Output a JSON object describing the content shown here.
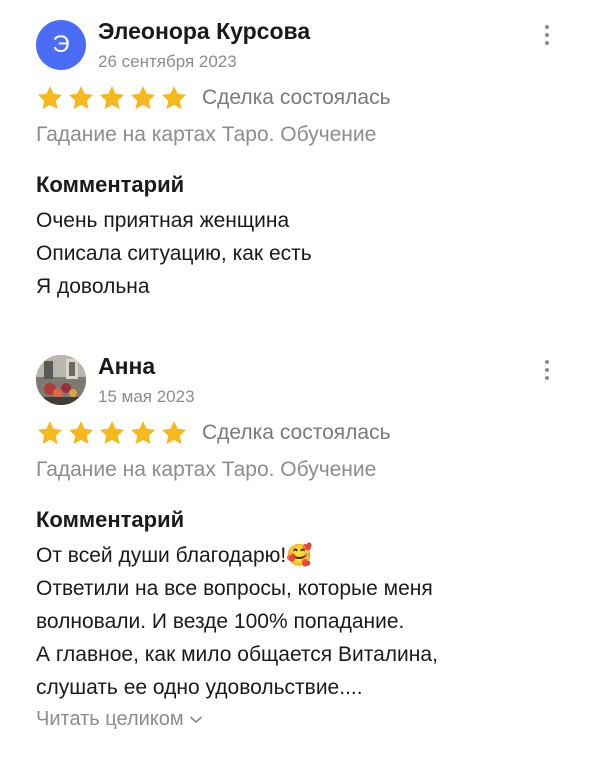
{
  "colors": {
    "star": "#f6b81c",
    "avatar_bg": "#4a6cf7",
    "muted_text": "#8c8c8c"
  },
  "reviews": [
    {
      "author": "Элеонора Курсова",
      "avatar_letter": "Э",
      "date": "26 сентября 2023",
      "rating": 5,
      "deal_status": "Сделка состоялась",
      "service": "Гадание на картах Таро. Обучение",
      "comment_title": "Комментарий",
      "comment_lines": [
        "Очень приятная женщина",
        "Описала ситуацию, как есть",
        "Я довольна"
      ]
    },
    {
      "author": "Анна",
      "avatar_icon": "user-photo",
      "date": "15 мая 2023",
      "rating": 5,
      "deal_status": "Сделка состоялась",
      "service": "Гадание на картах Таро. Обучение",
      "comment_title": "Комментарий",
      "comment_lines": [
        "От всей души благодарю!🥰",
        "Ответили на все вопросы, которые меня",
        "волновали. И везде 100% попадание.",
        "А главное, как мило общается Виталина,",
        "слушать ее одно удовольствие...."
      ],
      "read_more": "Читать целиком"
    }
  ]
}
